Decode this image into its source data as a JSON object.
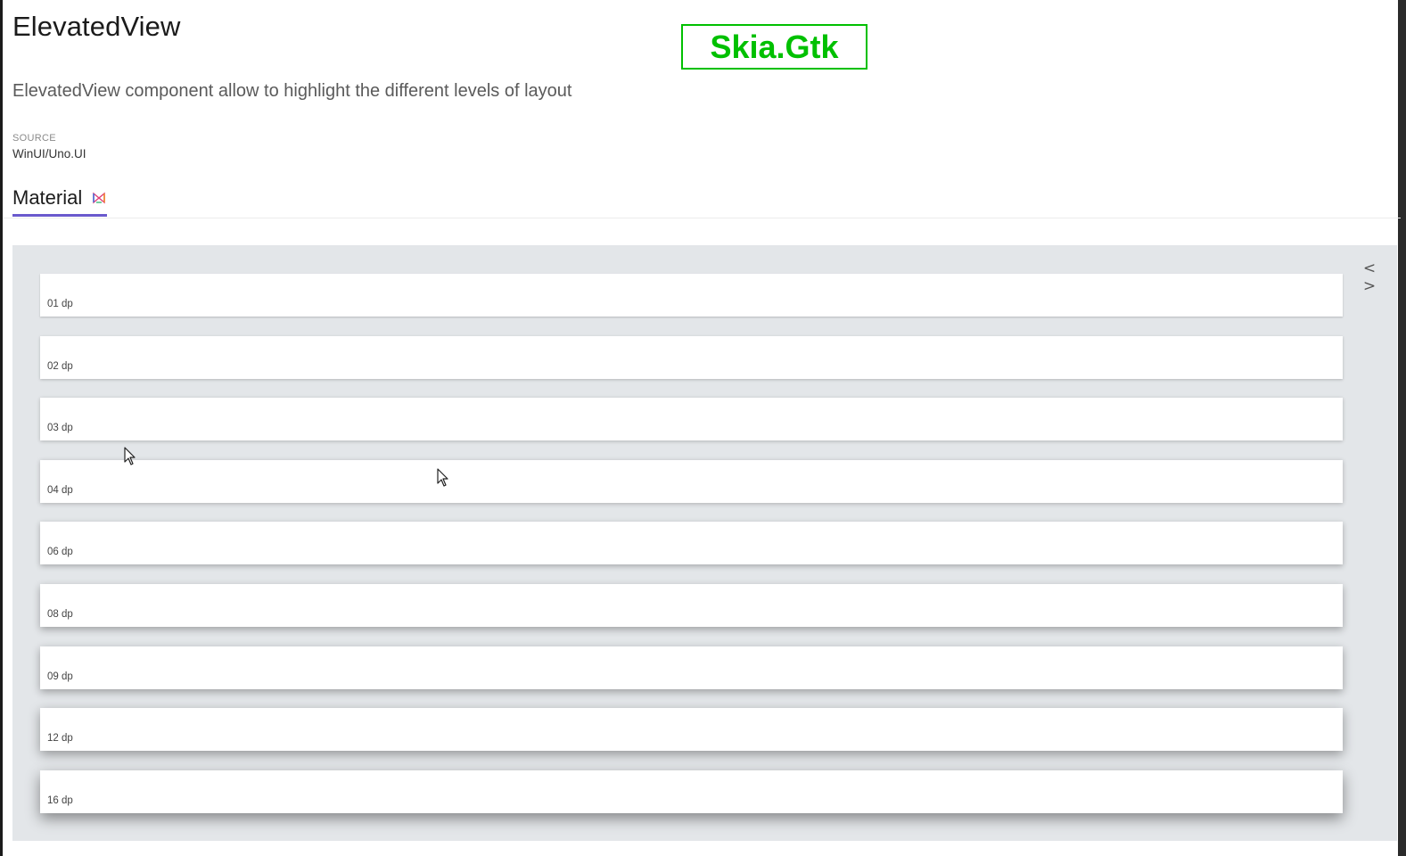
{
  "page": {
    "title": "ElevatedView",
    "platform_badge": "Skia.Gtk",
    "description": "ElevatedView component allow to highlight the different levels of layout",
    "source_label": "SOURCE",
    "source_value": "WinUI/Uno.UI"
  },
  "tabs": [
    {
      "label": "Material",
      "icon": "material-logo-icon",
      "selected": true
    }
  ],
  "sample": {
    "code_toggle_icon": "code-brackets-icon",
    "code_toggle_text": "< >",
    "cards": [
      {
        "label": "01 dp",
        "elevation": 1
      },
      {
        "label": "02 dp",
        "elevation": 2
      },
      {
        "label": "03 dp",
        "elevation": 3
      },
      {
        "label": "04 dp",
        "elevation": 4
      },
      {
        "label": "06 dp",
        "elevation": 6
      },
      {
        "label": "08 dp",
        "elevation": 8
      },
      {
        "label": "09 dp",
        "elevation": 9
      },
      {
        "label": "12 dp",
        "elevation": 12
      },
      {
        "label": "16 dp",
        "elevation": 16
      }
    ]
  },
  "colors": {
    "accent": "#6a5acd",
    "badge": "#00c000",
    "panel_background": "#e3e6e9"
  }
}
